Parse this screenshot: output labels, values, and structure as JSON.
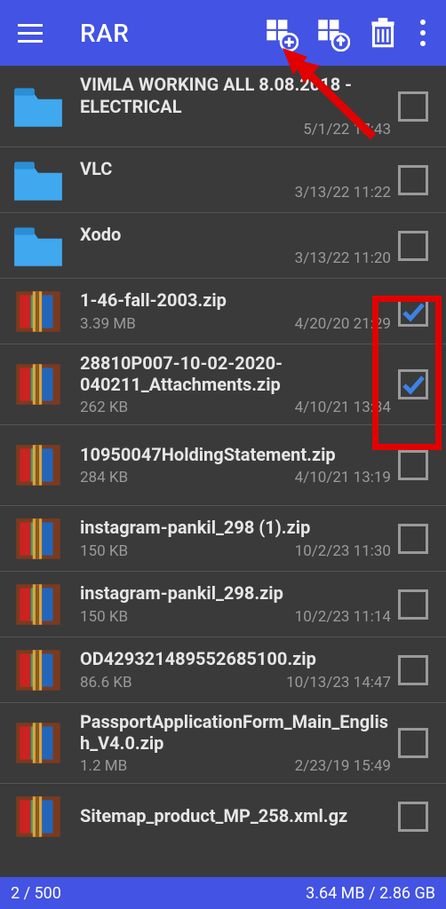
{
  "header": {
    "title": "RAR"
  },
  "items": [
    {
      "type": "folder",
      "name": "VIMLA WORKING ALL 8.08.2018 - ELECTRICAL",
      "date": "5/1/22 17:43",
      "checked": false
    },
    {
      "type": "folder",
      "name": "VLC",
      "date": "3/13/22 11:22",
      "checked": false
    },
    {
      "type": "folder",
      "name": "Xodo",
      "date": "3/13/22 11:20",
      "checked": false
    },
    {
      "type": "zip",
      "name": "1-46-fall-2003.zip",
      "size": "3.39 MB",
      "date": "4/20/20 21:29",
      "checked": true
    },
    {
      "type": "zip",
      "name": "28810P007-10-02-2020-040211_Attachments.zip",
      "size": "262 KB",
      "date": "4/10/21 13:34",
      "checked": true
    },
    {
      "type": "zip",
      "name": "10950047HoldingStatement.zip",
      "size": "284 KB",
      "date": "4/10/21 13:19",
      "checked": false
    },
    {
      "type": "zip",
      "name": "instagram-pankil_298 (1).zip",
      "size": "150 KB",
      "date": "10/2/23 11:30",
      "checked": false
    },
    {
      "type": "zip",
      "name": "instagram-pankil_298.zip",
      "size": "150 KB",
      "date": "10/2/23 11:14",
      "checked": false
    },
    {
      "type": "zip",
      "name": "OD429321489552685100.zip",
      "size": "86.6 KB",
      "date": "10/13/23 14:47",
      "checked": false
    },
    {
      "type": "zip",
      "name": "PassportApplicationForm_Main_English_V4.0.zip",
      "size": "1.2 MB",
      "date": "2/23/19 15:49",
      "checked": false
    },
    {
      "type": "zip",
      "name": "Sitemap_product_MP_258.xml.gz",
      "size": "",
      "date": "",
      "checked": false
    }
  ],
  "status": {
    "count": "2 / 500",
    "size": "3.64 MB / 2.86 GB"
  }
}
